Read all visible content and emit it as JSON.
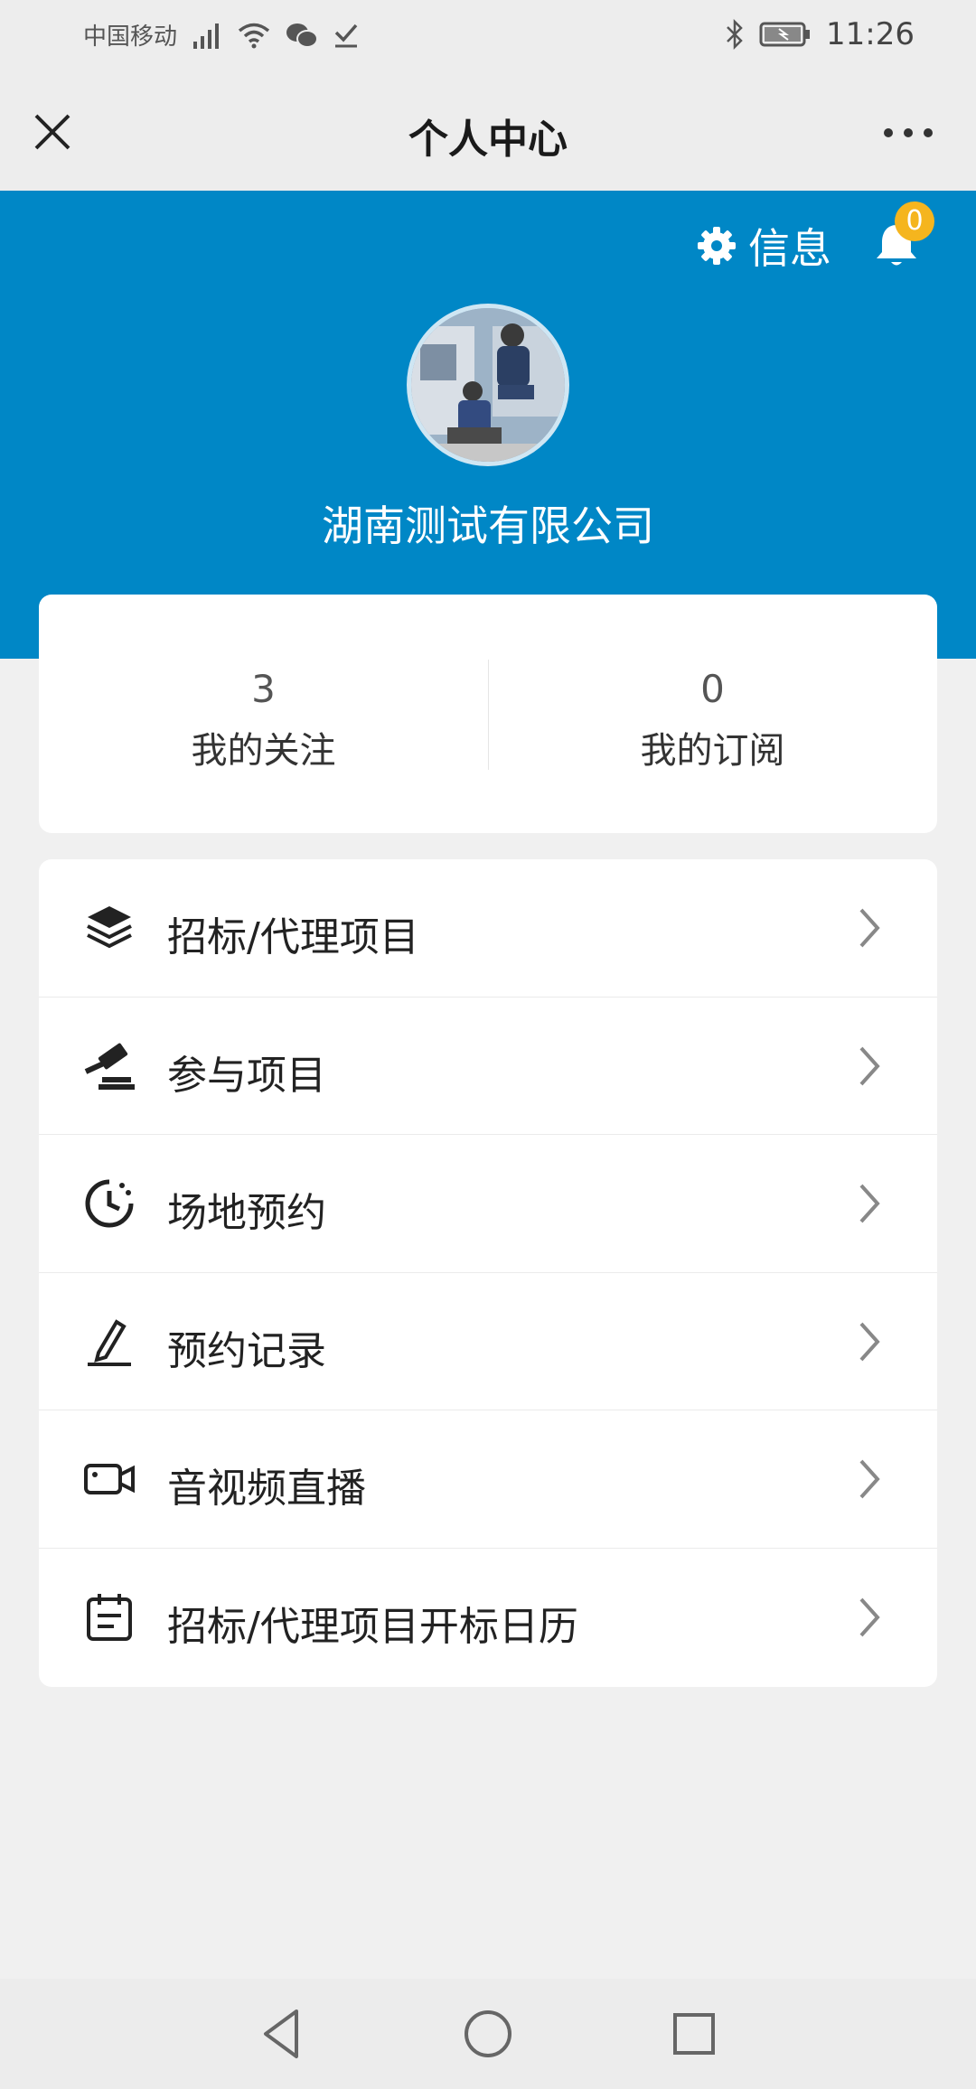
{
  "status_bar": {
    "carrier": "中国移动",
    "time": "11:26",
    "icons": [
      "signal-icon",
      "wifi-icon",
      "wechat-icon",
      "check-icon",
      "bluetooth-icon",
      "battery-icon"
    ]
  },
  "title_bar": {
    "title": "个人中心",
    "close_icon": "close-icon",
    "more_icon": "more-icon"
  },
  "header": {
    "settings_label": "信息",
    "notification_count": "0",
    "company_name": "湖南测试有限公司",
    "background_color": "#0087c6",
    "badge_color": "#f5b51e"
  },
  "stats": [
    {
      "value": "3",
      "label": "我的关注"
    },
    {
      "value": "0",
      "label": "我的订阅"
    }
  ],
  "menu": [
    {
      "label": "招标/代理项目",
      "icon": "layers-icon"
    },
    {
      "label": "参与项目",
      "icon": "gavel-icon"
    },
    {
      "label": "场地预约",
      "icon": "clock-icon"
    },
    {
      "label": "预约记录",
      "icon": "pen-icon"
    },
    {
      "label": "音视频直播",
      "icon": "video-icon"
    },
    {
      "label": "招标/代理项目开标日历",
      "icon": "calendar-icon"
    }
  ],
  "nav_bar": {
    "icons": [
      "back-icon",
      "home-icon",
      "recents-icon"
    ]
  }
}
